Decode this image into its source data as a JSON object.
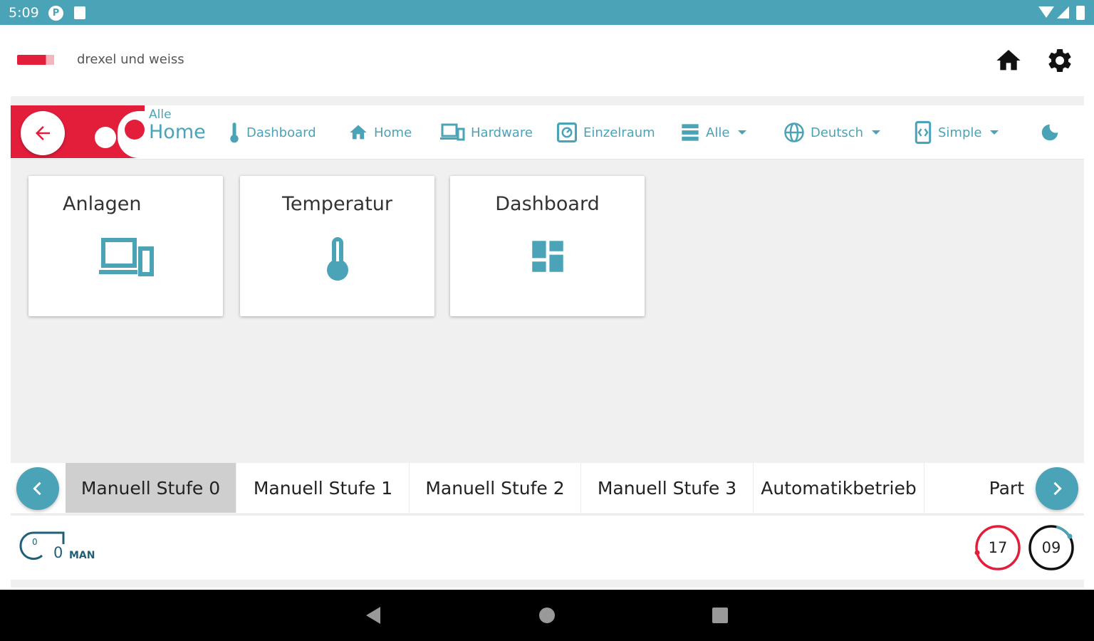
{
  "status_bar": {
    "time": "5:09",
    "icon1": "P"
  },
  "app": {
    "logo_text": "drexel und weiss"
  },
  "breadcrumb": {
    "parent": "Alle",
    "current": "Home"
  },
  "nav": {
    "dashboard": "Dashboard",
    "home": "Home",
    "hardware": "Hardware",
    "room": "Einzelraum",
    "all": "Alle",
    "language": "Deutsch",
    "mode": "Simple"
  },
  "cards": [
    {
      "title": "Anlagen",
      "icon": "devices-icon"
    },
    {
      "title": "Temperatur",
      "icon": "thermometer-icon"
    },
    {
      "title": "Dashboard",
      "icon": "dashboard-icon"
    }
  ],
  "modes": [
    {
      "label": "Manuell Stufe 0",
      "active": true
    },
    {
      "label": "Manuell Stufe 1",
      "active": false
    },
    {
      "label": "Manuell Stufe 2",
      "active": false
    },
    {
      "label": "Manuell Stufe 3",
      "active": false
    },
    {
      "label": "Automatikbetrieb",
      "active": false
    },
    {
      "label": "Part",
      "active": false
    }
  ],
  "footer": {
    "fan_inner": "0",
    "fan_level": "0",
    "fan_mode": "MAN",
    "gauge1": "17",
    "gauge2": "09"
  },
  "colors": {
    "accent": "#4aa3b6",
    "brand_red": "#e31e3b",
    "status_bar": "#4aa3b6"
  }
}
